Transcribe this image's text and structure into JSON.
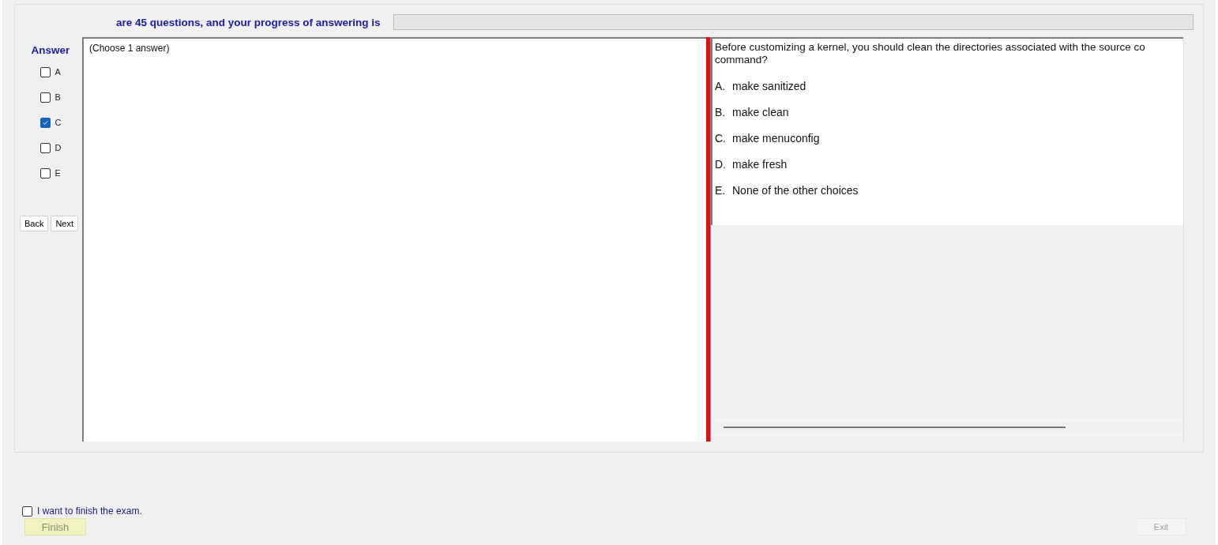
{
  "header": {
    "text": "are 45 questions, and your progress of answering is",
    "progress": {
      "level": 0
    }
  },
  "answer_panel": {
    "title": "Answer",
    "choices": [
      {
        "label": "A",
        "checked": false
      },
      {
        "label": "B",
        "checked": false
      },
      {
        "label": "C",
        "checked": true
      },
      {
        "label": "D",
        "checked": false
      },
      {
        "label": "E",
        "checked": false
      }
    ],
    "buttons": [
      "Back",
      "Next"
    ]
  },
  "answer_note": "(Choose 1 answer)",
  "question": {
    "lines": [
      "Before customizing a kernel, you should clean the directories associated with the source co",
      "command?"
    ],
    "options": [
      {
        "letter": "A.",
        "text": "make sanitized"
      },
      {
        "letter": "B.",
        "text": "make clean"
      },
      {
        "letter": "C.",
        "text": "make menuconfig"
      },
      {
        "letter": "D.",
        "text": "make fresh"
      },
      {
        "letter": "E.",
        "text": "None of the other choices"
      }
    ]
  },
  "finish": {
    "label": "I want to finish the exam.",
    "checked": false,
    "button": "Finish",
    "disabled": true
  },
  "exit": {
    "label": "Exit",
    "disabled": true
  }
}
